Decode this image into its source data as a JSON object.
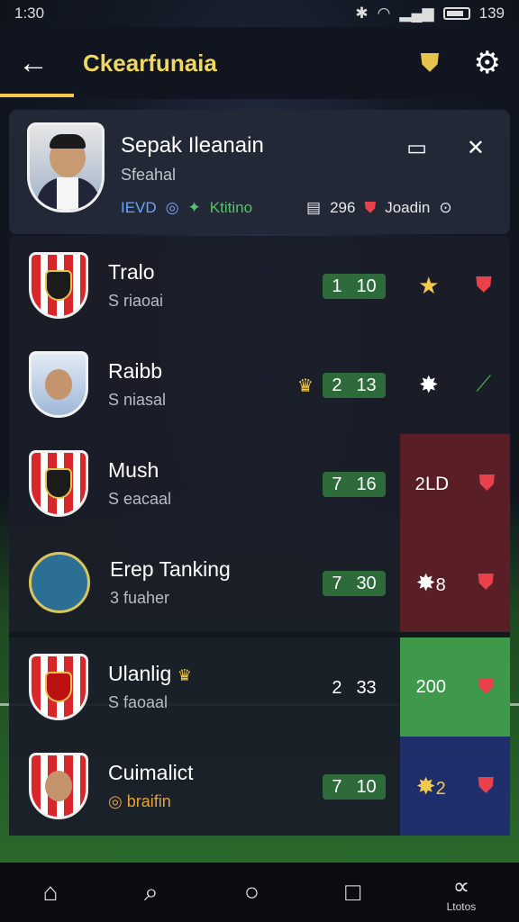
{
  "status": {
    "time": "1:30",
    "battery": "139"
  },
  "header": {
    "title": "Ckearfunaia"
  },
  "profile": {
    "name": "Sepak Ileanain",
    "sub": "Sfeahal",
    "lvl": "IEVD",
    "status_label": "Ktitino",
    "score": "296",
    "extra": "Joadin"
  },
  "rows": [
    {
      "name": "Tralo",
      "sub": "S riaoai",
      "score_a": "1",
      "score_b": "10",
      "right": ""
    },
    {
      "name": "Raibb",
      "sub": "S niasal",
      "score_a": "2",
      "score_b": "13",
      "right": ""
    },
    {
      "name": "Mush",
      "sub": "S eacaal",
      "score_a": "7",
      "score_b": "16",
      "right": "2ⅬⅮ"
    },
    {
      "name": "Erep Tanking",
      "sub": "3 fuaher",
      "score_a": "7",
      "score_b": "30",
      "right": "8"
    },
    {
      "name": "Ulanlig",
      "sub": "S faoaal",
      "score_a": "2",
      "score_b": "33",
      "right": "200"
    },
    {
      "name": "Cuimalict",
      "sub": "braifin",
      "score_a": "7",
      "score_b": "10",
      "right": "2"
    }
  ],
  "nav": {
    "last_label": "Ltotos"
  }
}
